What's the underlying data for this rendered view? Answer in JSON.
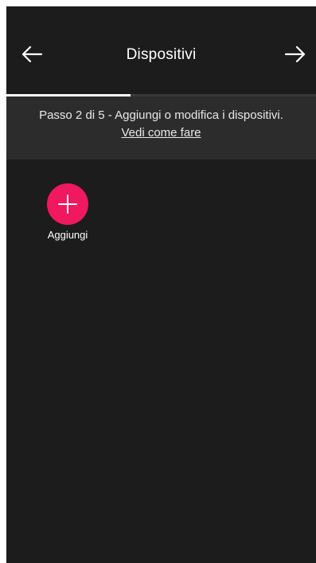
{
  "header": {
    "title": "Dispositivi",
    "back_icon": "arrow-left-icon",
    "next_icon": "arrow-right-icon"
  },
  "progress": {
    "step": 2,
    "total": 5,
    "fraction": 0.4
  },
  "info": {
    "text": "Passo 2 di 5 - Aggiungi o modifica i dispositivi.",
    "link": "Vedi come fare"
  },
  "add_tile": {
    "label": "Aggiungi",
    "icon": "plus-icon",
    "color": "#f0185f"
  }
}
